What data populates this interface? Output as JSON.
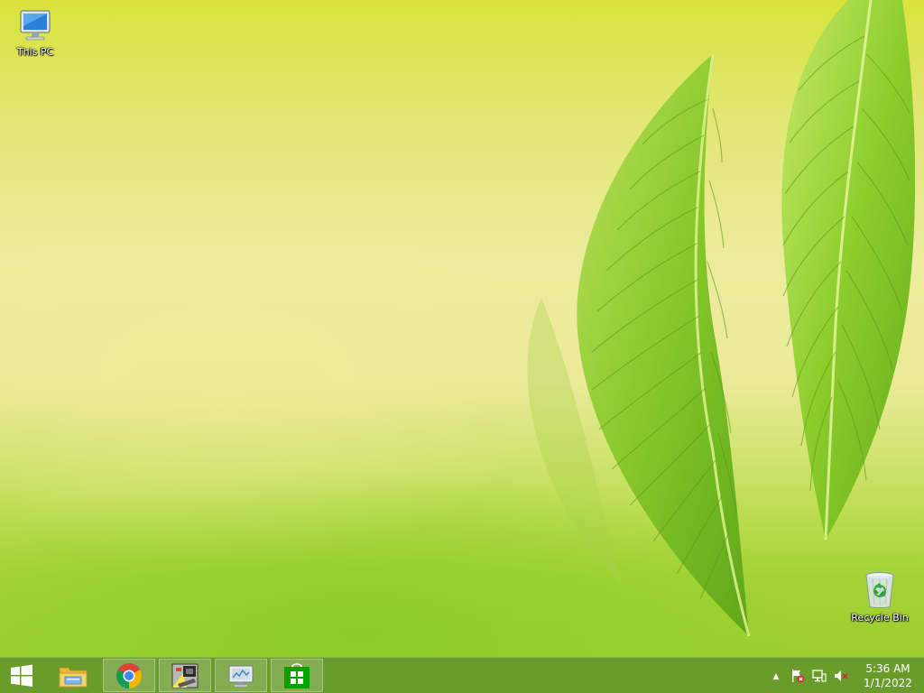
{
  "desktop": {
    "icons": [
      {
        "label": "This PC",
        "icon": "this-pc-icon"
      },
      {
        "label": "Recycle Bin",
        "icon": "recycle-bin-icon"
      }
    ],
    "wallpaper": {
      "accent": "#a2d333",
      "leaf_color": "#7cc21e"
    }
  },
  "taskbar": {
    "background": "#6a9c2c",
    "start_icon": "windows-logo-icon",
    "pinned": [
      {
        "name": "File Explorer",
        "icon": "file-explorer-icon",
        "active": false
      },
      {
        "name": "Google Chrome",
        "icon": "chrome-icon",
        "active": true
      },
      {
        "name": "Application",
        "icon": "app-icon",
        "active": true
      },
      {
        "name": "Application",
        "icon": "monitor-app-icon",
        "active": true
      },
      {
        "name": "Store",
        "icon": "store-icon",
        "active": true
      }
    ],
    "tray": {
      "icons": [
        "show-hidden-icons-chevron",
        "action-center-flag-icon",
        "network-icon",
        "volume-muted-icon"
      ],
      "time": "5:36 AM",
      "date": "1/1/2022"
    }
  }
}
